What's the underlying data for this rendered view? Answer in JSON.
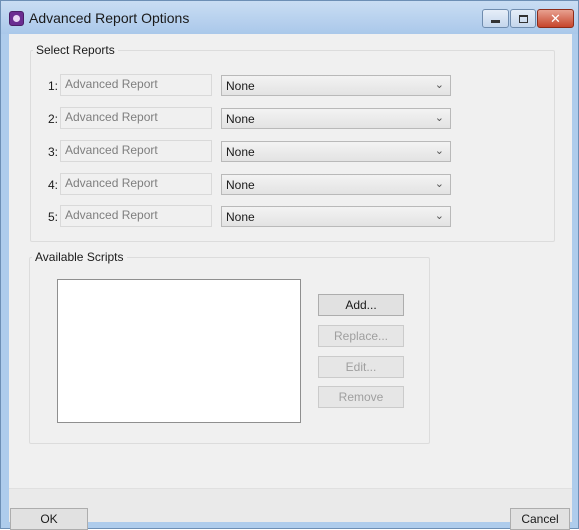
{
  "window": {
    "title": "Advanced Report Options",
    "icon": "app-icon",
    "controls": {
      "minimize": "minimize-icon",
      "maximize": "maximize-icon",
      "close": "✕"
    }
  },
  "reports_group": {
    "legend": "Select Reports",
    "rows": [
      {
        "number": "1:",
        "report": "Advanced Report",
        "selection": "None"
      },
      {
        "number": "2:",
        "report": "Advanced Report",
        "selection": "None"
      },
      {
        "number": "3:",
        "report": "Advanced Report",
        "selection": "None"
      },
      {
        "number": "4:",
        "report": "Advanced Report",
        "selection": "None"
      },
      {
        "number": "5:",
        "report": "Advanced Report",
        "selection": "None"
      }
    ]
  },
  "scripts_group": {
    "legend": "Available Scripts",
    "buttons": {
      "add": "Add...",
      "replace": "Replace...",
      "edit": "Edit...",
      "remove": "Remove"
    }
  },
  "footer": {
    "ok": "OK",
    "cancel": "Cancel"
  }
}
